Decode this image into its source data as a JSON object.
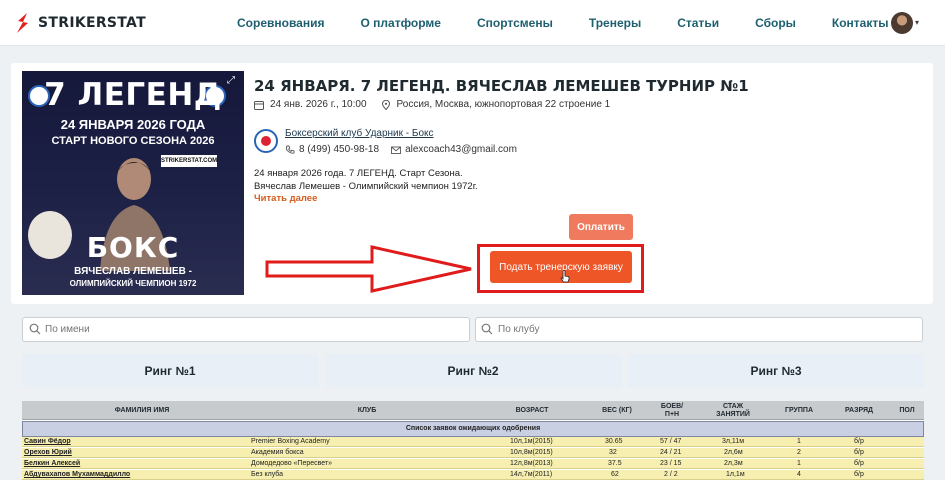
{
  "brand": {
    "name": "STRIKERSTAT",
    "accent": "#e0241b"
  },
  "nav": [
    "Соревнования",
    "О платформе",
    "Спортсмены",
    "Тренеры",
    "Статьи",
    "Сборы",
    "Контакты"
  ],
  "event": {
    "title": "24 ЯНВАРЯ. 7 ЛЕГЕНД. ВЯЧЕСЛАВ ЛЕМЕШЕВ ТУРНИР №1",
    "datetime": "24 янв. 2026 г., 10:00",
    "location": "Россия, Москва, южнопортовая 22 строение 1",
    "club": "Боксерский клуб Ударник - Бокс",
    "phone": "8 (499) 450-98-18",
    "email": "alexcoach43@gmail.com",
    "desc_line1": "24 января 2026 года. 7 ЛЕГЕНД. Старт Сезона.",
    "desc_line2": "Вячеслав Лемешев - Олимпийский чемпион 1972г.",
    "read_more": "Читать далее",
    "pay_label": "Оплатить",
    "apply_label": "Подать тренерскую заявку",
    "poster": {
      "title": "7 ЛЕГЕНД",
      "date": "24 ЯНВАРЯ 2026 ГОДА",
      "season": "СТАРТ НОВОГО СЕЗОНА 2026",
      "badge": "STRIKERSTAT.COM",
      "sport": "БОКС",
      "name": "ВЯЧЕСЛАВ ЛЕМЕШЕВ -",
      "champion": "ОЛИМПИЙСКИЙ ЧЕМПИОН 1972"
    }
  },
  "search": {
    "name_placeholder": "По имени",
    "club_placeholder": "По клубу"
  },
  "rings": [
    "Ринг №1",
    "Ринг №2",
    "Ринг №3"
  ],
  "table": {
    "headers": {
      "name": "ФАМИЛИЯ ИМЯ",
      "club": "КЛУБ",
      "age": "ВОЗРАСТ",
      "weight": "ВЕС (КГ)",
      "fights_1": "БОЕВ/",
      "fights_2": "П+Н",
      "exp_1": "СТАЖ",
      "exp_2": "ЗАНЯТИЙ",
      "group": "ГРУППА",
      "rank": "РАЗРЯД",
      "sex": "ПОЛ"
    },
    "pending_label": "Список заявок ожидающих одобрения",
    "rows": [
      {
        "name": "Савин Фёдор",
        "club": "Premier Boxing Academy",
        "age": "10л,1м(2015)",
        "weight": "30.65",
        "fights": "57 / 47",
        "exp": "3л,11м",
        "group": "1",
        "rank": "б/р"
      },
      {
        "name": "Орехов Юрий",
        "club": "Академия бокса",
        "age": "10л,8м(2015)",
        "weight": "32",
        "fights": "24 / 21",
        "exp": "2л,6м",
        "group": "2",
        "rank": "б/р"
      },
      {
        "name": "Белкин Алексей",
        "club": "Домодедово «Пересвет»",
        "age": "12л,8м(2013)",
        "weight": "37.5",
        "fights": "23 / 15",
        "exp": "2л,3м",
        "group": "1",
        "rank": "б/р"
      },
      {
        "name": "Абдувахапов Мухаммаддилло",
        "club": "Без клуба",
        "age": "14л,7м(2011)",
        "weight": "62",
        "fights": "2 / 2",
        "exp": "1л,1м",
        "group": "4",
        "rank": "б/р"
      }
    ]
  }
}
